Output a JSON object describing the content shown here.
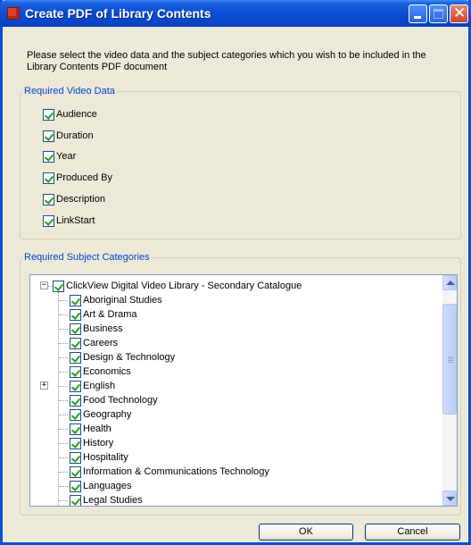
{
  "window": {
    "title": "Create PDF of Library Contents"
  },
  "intro_text": "Please select the video data and the subject categories which you wish to be included in the Library Contents PDF document",
  "video_data": {
    "legend": "Required Video Data",
    "items": [
      {
        "label": "Audience",
        "checked": true
      },
      {
        "label": "Duration",
        "checked": true
      },
      {
        "label": "Year",
        "checked": true
      },
      {
        "label": "Produced By",
        "checked": true
      },
      {
        "label": "Description",
        "checked": true
      },
      {
        "label": "LinkStart",
        "checked": true
      }
    ]
  },
  "subject_categories": {
    "legend": "Required Subject Categories",
    "root": {
      "label": "ClickView Digital Video Library - Secondary Catalogue",
      "checked": true,
      "expanded": true
    },
    "children": [
      {
        "label": "Aboriginal Studies",
        "checked": true
      },
      {
        "label": "Art & Drama",
        "checked": true
      },
      {
        "label": "Business",
        "checked": true
      },
      {
        "label": "Careers",
        "checked": true
      },
      {
        "label": "Design & Technology",
        "checked": true
      },
      {
        "label": "Economics",
        "checked": true
      },
      {
        "label": "English",
        "checked": true,
        "expandable": true
      },
      {
        "label": "Food Technology",
        "checked": true
      },
      {
        "label": "Geography",
        "checked": true
      },
      {
        "label": "Health",
        "checked": true
      },
      {
        "label": "History",
        "checked": true
      },
      {
        "label": "Hospitality",
        "checked": true
      },
      {
        "label": "Information & Communications Technology",
        "checked": true
      },
      {
        "label": "Languages",
        "checked": true
      },
      {
        "label": "Legal Studies",
        "checked": true
      }
    ]
  },
  "buttons": {
    "ok": "OK",
    "cancel": "Cancel"
  }
}
